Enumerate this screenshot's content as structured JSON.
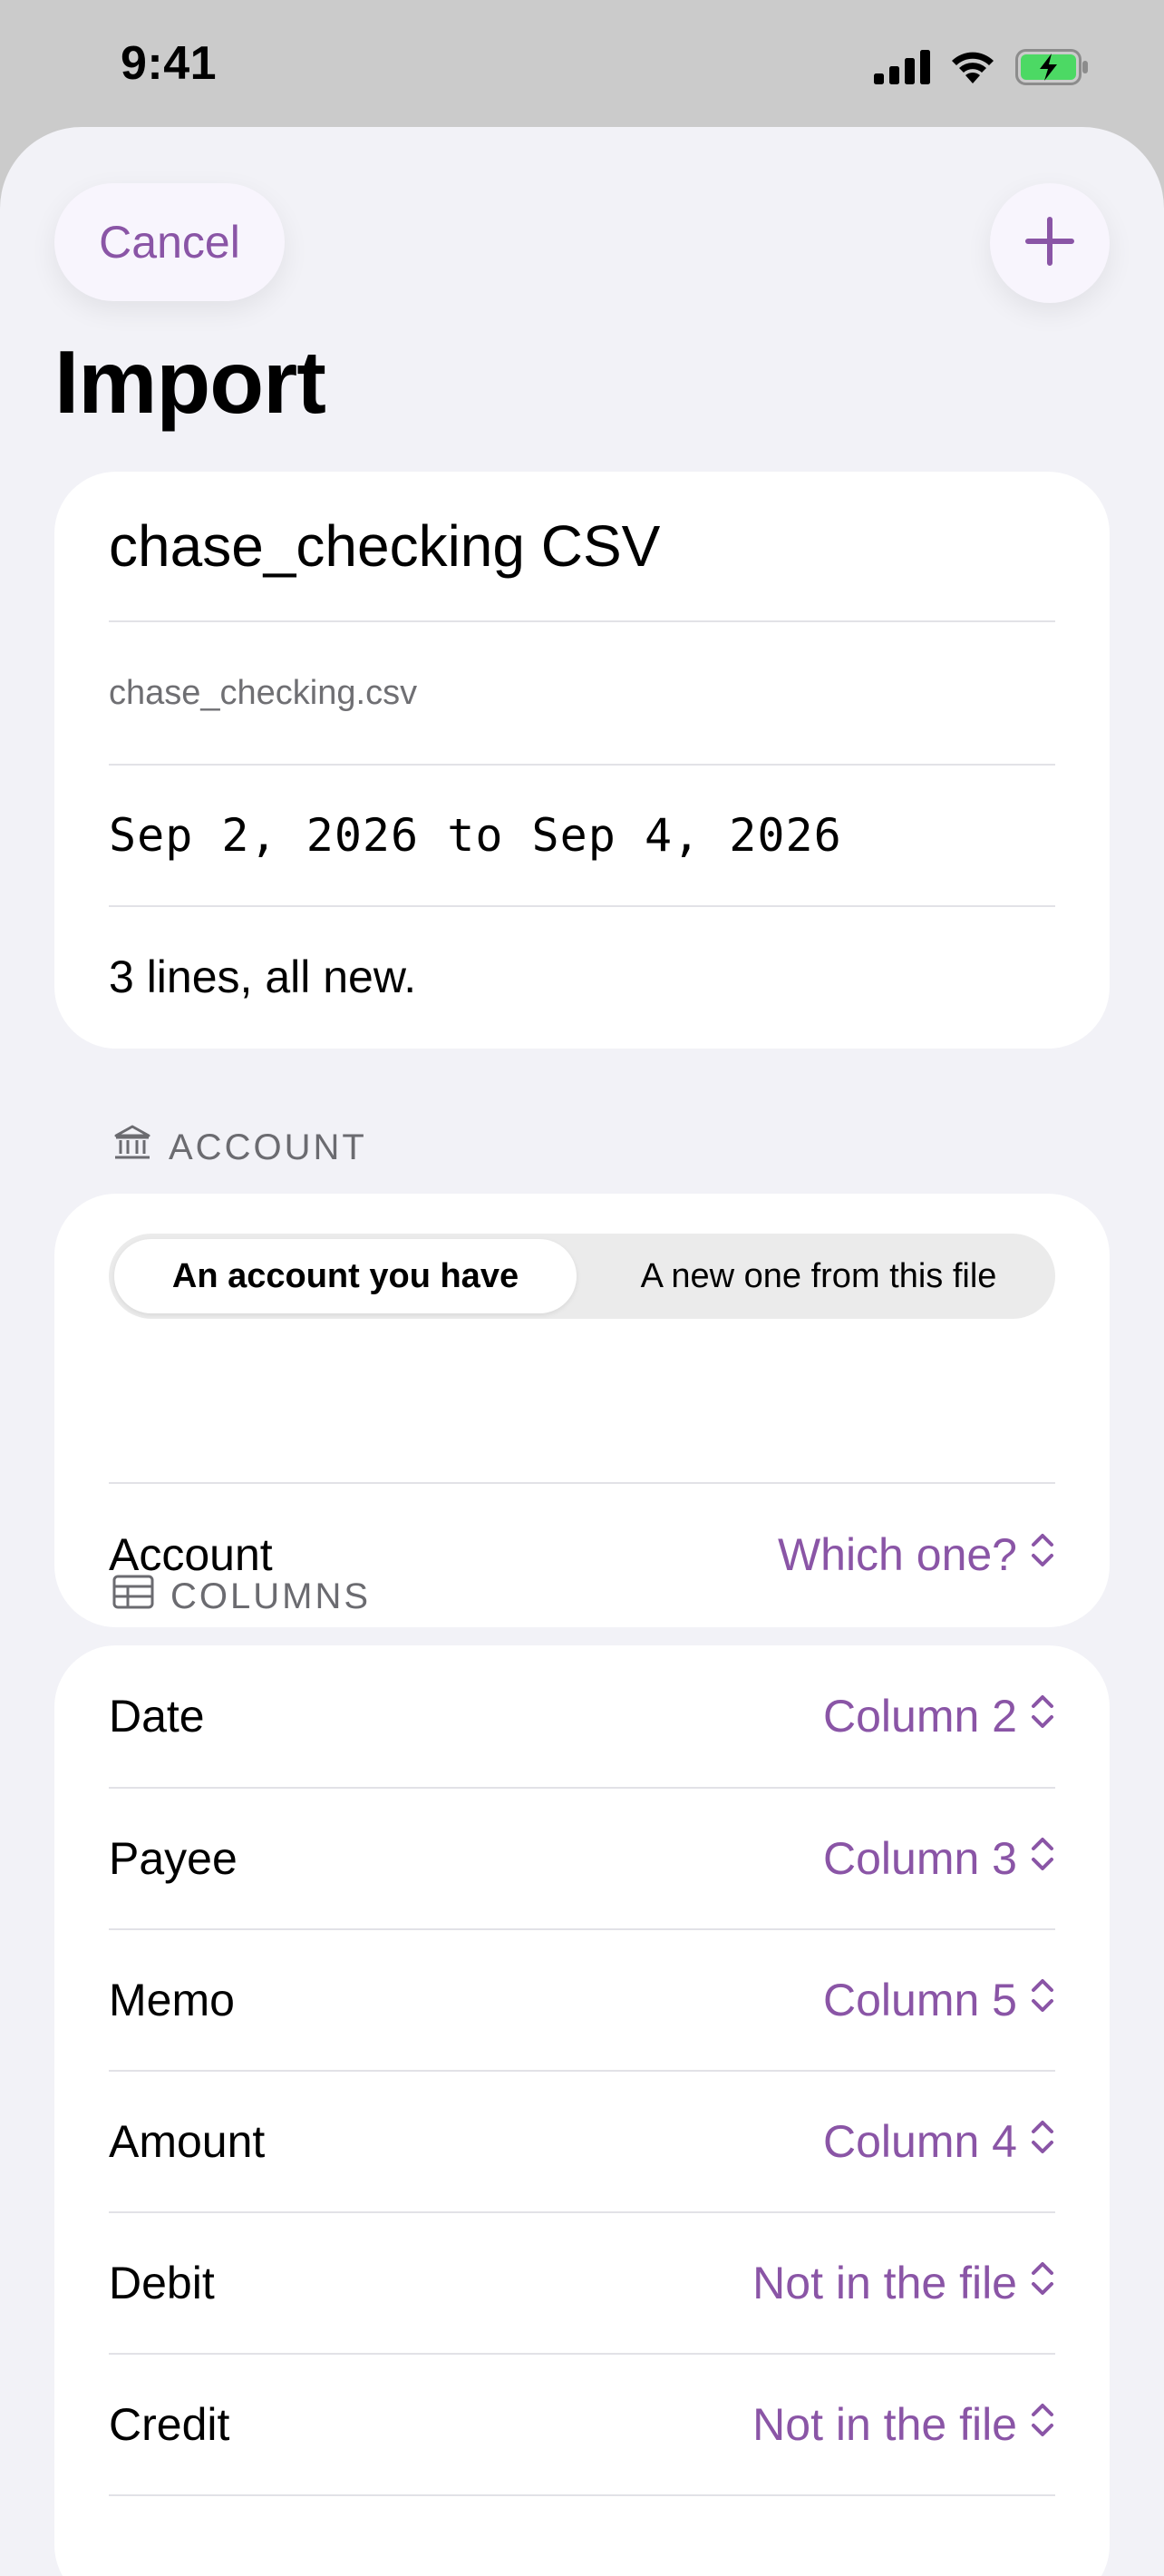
{
  "status_bar": {
    "time": "9:41",
    "icons": [
      "cellular-signal-icon",
      "wifi-icon",
      "battery-charging-icon"
    ]
  },
  "header": {
    "cancel_label": "Cancel",
    "add_icon": "plus-icon",
    "title": "Import"
  },
  "file_info": {
    "title": "chase_checking CSV",
    "file_name": "chase_checking.csv",
    "date_range": "Sep 2, 2026 to Sep 4, 2026",
    "summary": "3 lines, all new."
  },
  "account_section": {
    "header_icon": "bank-icon",
    "header": "ACCOUNT",
    "segments": [
      "An account you have",
      "A new one from this file"
    ],
    "selected_segment": "An account you have",
    "account_label": "Account",
    "account_value": "Which one?"
  },
  "columns_section": {
    "header_icon": "table-icon",
    "header": "COLUMNS",
    "rows": [
      {
        "label": "Date",
        "value": "Column 2"
      },
      {
        "label": "Payee",
        "value": "Column 3"
      },
      {
        "label": "Memo",
        "value": "Column 5"
      },
      {
        "label": "Amount",
        "value": "Column 4"
      },
      {
        "label": "Debit",
        "value": "Not in the file"
      },
      {
        "label": "Credit",
        "value": "Not in the file"
      }
    ]
  },
  "colors": {
    "accent": "#8a55a6",
    "background": "#f2f2f7",
    "card": "#ffffff",
    "status_bar_bg": "#cbcbcb",
    "battery_green": "#4cd964"
  }
}
